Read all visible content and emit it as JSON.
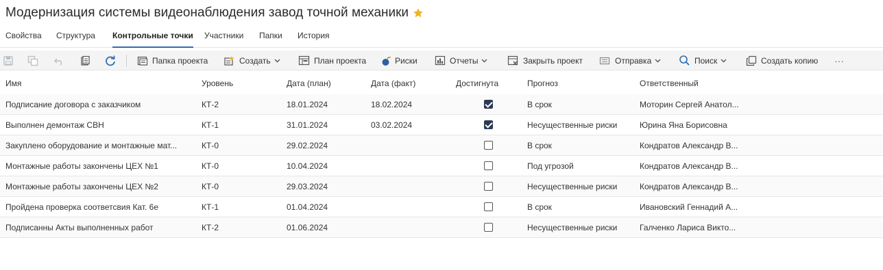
{
  "page": {
    "title": "Модернизация системы видеонаблюдения завод точной механики",
    "star_color": "#f0b323"
  },
  "tabs": [
    {
      "label": "Свойства"
    },
    {
      "label": "Структура"
    },
    {
      "label": "Контрольные точки",
      "active": true
    },
    {
      "label": "Участники"
    },
    {
      "label": "Папки"
    },
    {
      "label": "История"
    }
  ],
  "toolbar": {
    "save_icon": "save-icon",
    "save_as_icon": "save-copy-icon",
    "undo_icon": "undo-icon",
    "clipboard_icon": "clipboard-icon",
    "refresh_icon": "refresh-icon",
    "project_folder": "Папка проекта",
    "create": "Создать",
    "project_plan": "План проекта",
    "risks": "Риски",
    "reports": "Отчеты",
    "close_project": "Закрыть проект",
    "send": "Отправка",
    "search": "Поиск",
    "create_copy": "Создать копию",
    "more": "···"
  },
  "table": {
    "columns": [
      "Имя",
      "Уровень",
      "Дата (план)",
      "Дата (факт)",
      "Достигнута",
      "Прогноз",
      "Ответственный"
    ],
    "rows": [
      {
        "name": "Подписание договора с заказчиком",
        "level": "КТ-2",
        "plan": "18.01.2024",
        "fact": "18.02.2024",
        "achieved": true,
        "forecast": "В срок",
        "owner": "Моторин Сергей Анатол..."
      },
      {
        "name": "Выполнен демонтаж СВН",
        "level": "КТ-1",
        "plan": "31.01.2024",
        "fact": "03.02.2024",
        "achieved": true,
        "forecast": "Несущественные риски",
        "owner": "Юрина Яна Борисовна"
      },
      {
        "name": "Закуплено оборудование и монтажные мат...",
        "level": "КТ-0",
        "plan": "29.02.2024",
        "fact": "",
        "achieved": false,
        "forecast": "В срок",
        "owner": "Кондратов Александр В..."
      },
      {
        "name": "Монтажные работы закончены ЦЕХ №1",
        "level": "КТ-0",
        "plan": "10.04.2024",
        "fact": "",
        "achieved": false,
        "forecast": "Под угрозой",
        "owner": "Кондратов Александр В..."
      },
      {
        "name": "Монтажные работы закончены ЦЕХ №2",
        "level": "КТ-0",
        "plan": "29.03.2024",
        "fact": "",
        "achieved": false,
        "forecast": "Несущественные риски",
        "owner": "Кондратов Александр В..."
      },
      {
        "name": "Пройдена проверка соответсвия Кат. 6е",
        "level": "КТ-1",
        "plan": "01.04.2024",
        "fact": "",
        "achieved": false,
        "forecast": "В срок",
        "owner": "Ивановский Геннадий А..."
      },
      {
        "name": "Подписанны Акты выполненных работ",
        "level": "КТ-2",
        "plan": "01.06.2024",
        "fact": "",
        "achieved": false,
        "forecast": "Несущественные риски",
        "owner": "Галченко Лариса Викто..."
      }
    ]
  }
}
